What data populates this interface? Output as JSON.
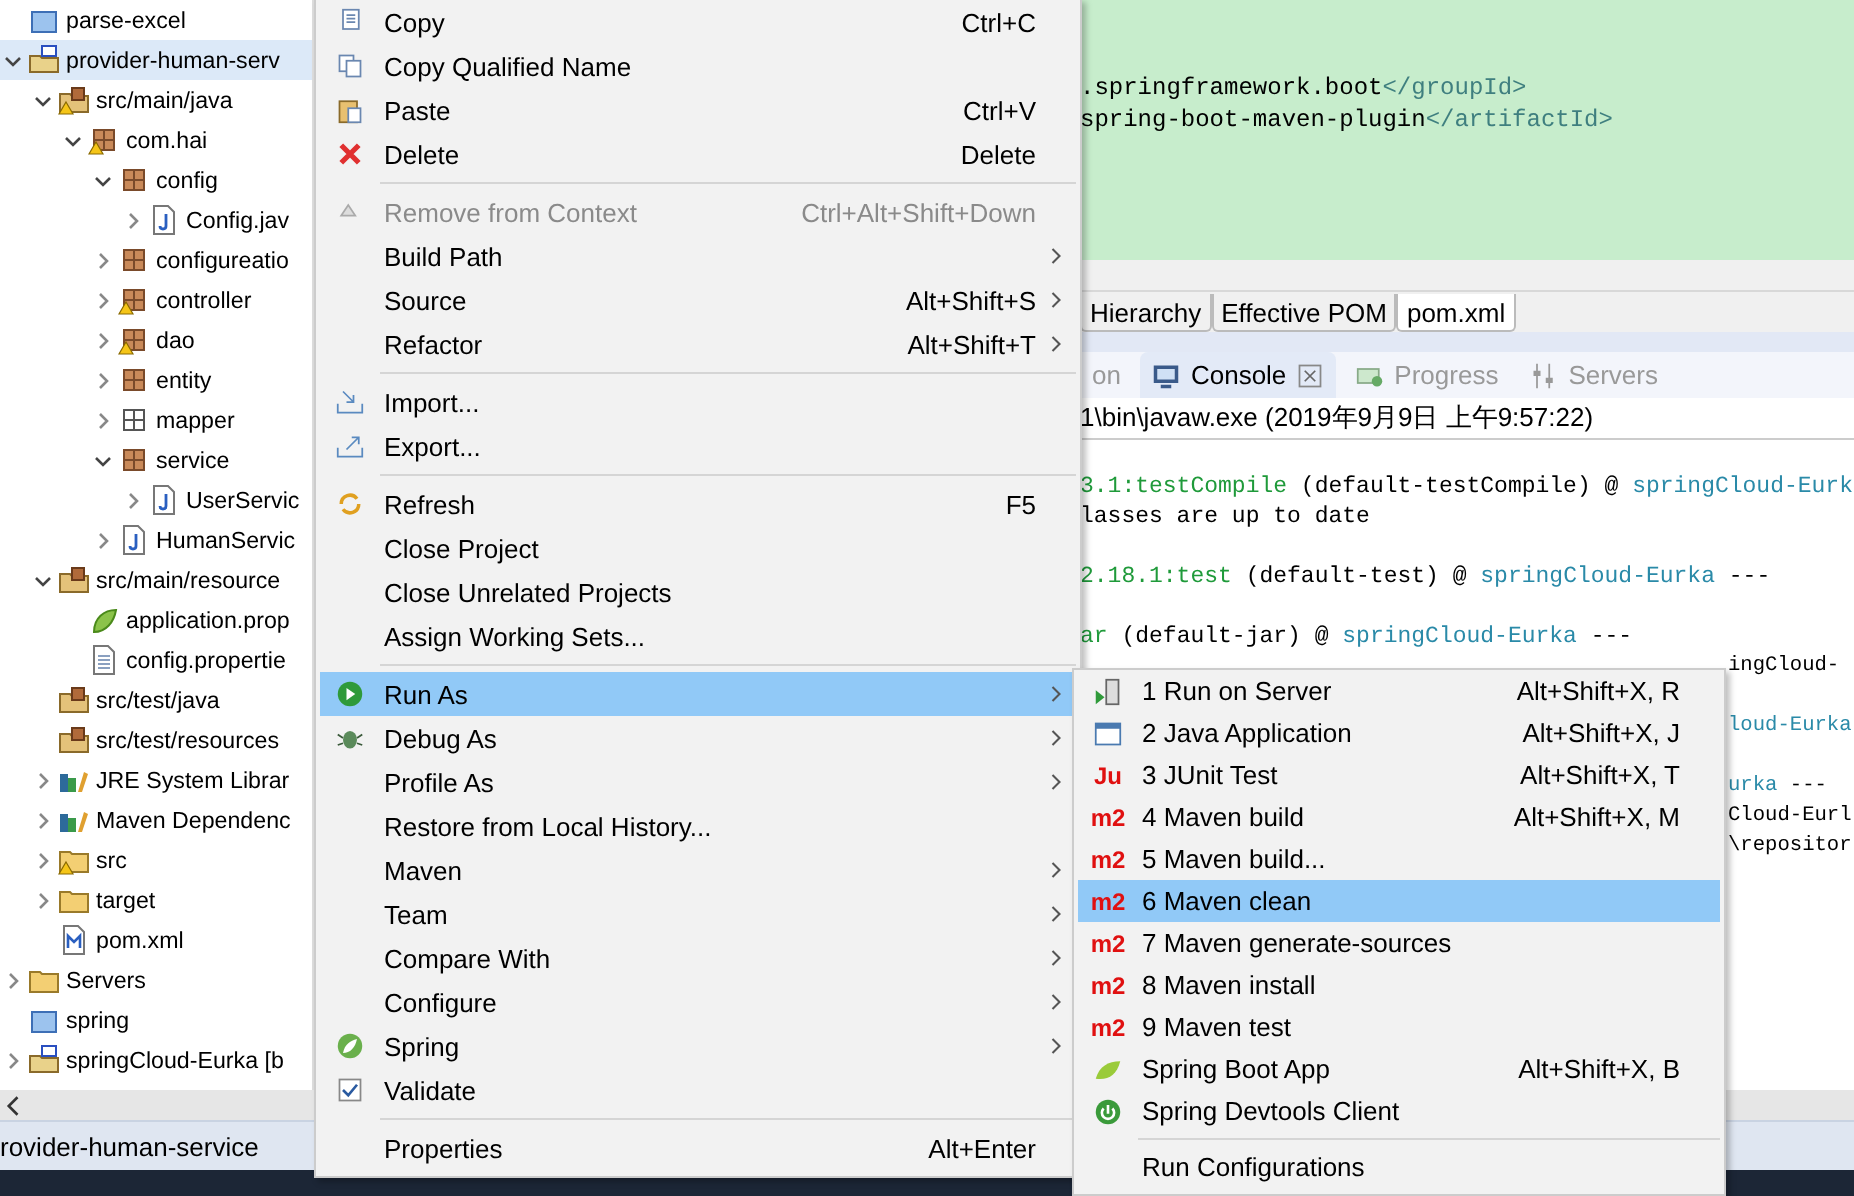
{
  "project_tree": {
    "items": [
      {
        "label": "parse-excel",
        "kind": "project",
        "selected": false
      },
      {
        "label": "provider-human-serv",
        "kind": "maven-project",
        "selected": true,
        "expanded": true,
        "children": [
          {
            "label": "src/main/java",
            "kind": "source-folder",
            "warning": true,
            "selected": false,
            "expanded": true,
            "children": [
              {
                "label": "com.hai",
                "kind": "package",
                "warning": true,
                "selected": false,
                "expanded": true,
                "children": [
                  {
                    "label": "config",
                    "kind": "package",
                    "selected": false,
                    "expanded": true,
                    "children": [
                      {
                        "label": "Config.jav",
                        "kind": "java-file",
                        "selected": false,
                        "expanded": false
                      }
                    ]
                  },
                  {
                    "label": "configureatio",
                    "kind": "package",
                    "selected": false,
                    "expanded": false
                  },
                  {
                    "label": "controller",
                    "kind": "package",
                    "warning": true,
                    "selected": false,
                    "expanded": false
                  },
                  {
                    "label": "dao",
                    "kind": "package",
                    "warning": true,
                    "selected": false,
                    "expanded": false
                  },
                  {
                    "label": "entity",
                    "kind": "package",
                    "selected": false,
                    "expanded": false
                  },
                  {
                    "label": "mapper",
                    "kind": "empty-package",
                    "selected": false,
                    "expanded": false
                  },
                  {
                    "label": "service",
                    "kind": "package",
                    "selected": false,
                    "expanded": true,
                    "children": [
                      {
                        "label": "UserServic",
                        "kind": "java-file",
                        "selected": false,
                        "expanded": false
                      }
                    ]
                  },
                  {
                    "label": "HumanServic",
                    "kind": "java-file",
                    "selected": false,
                    "expanded": false
                  }
                ]
              }
            ]
          },
          {
            "label": "src/main/resource",
            "kind": "source-folder",
            "selected": false,
            "expanded": true,
            "children": [
              {
                "label": "application.prop",
                "kind": "spring-file",
                "selected": false
              },
              {
                "label": "config.propertie",
                "kind": "text-file",
                "selected": false
              }
            ]
          },
          {
            "label": "src/test/java",
            "kind": "source-folder",
            "selected": false
          },
          {
            "label": "src/test/resources",
            "kind": "source-folder",
            "selected": false
          },
          {
            "label": "JRE System Librar",
            "kind": "library",
            "selected": false,
            "expanded": false
          },
          {
            "label": "Maven Dependenc",
            "kind": "library",
            "selected": false,
            "expanded": false
          },
          {
            "label": "src",
            "kind": "folder",
            "warning": true,
            "selected": false,
            "expanded": false
          },
          {
            "label": "target",
            "kind": "folder",
            "selected": false,
            "expanded": false
          },
          {
            "label": "pom.xml",
            "kind": "xml-file",
            "selected": false
          }
        ]
      },
      {
        "label": "Servers",
        "kind": "folder",
        "selected": false,
        "expanded": false
      },
      {
        "label": "spring",
        "kind": "project",
        "selected": false
      },
      {
        "label": "springCloud-Eurka [b",
        "kind": "maven-project",
        "selected": false,
        "expanded": false
      }
    ]
  },
  "editor": {
    "lines": [
      {
        "segments": [
          {
            "text": ".springframework.boot",
            "kind": "text"
          },
          {
            "text": "</groupId>",
            "kind": "tag"
          }
        ]
      },
      {
        "segments": [
          {
            "text": "spring-boot-maven-plugin",
            "kind": "text"
          },
          {
            "text": "</artifactId>",
            "kind": "tag"
          }
        ]
      }
    ],
    "tabs": [
      {
        "label": "Hierarchy",
        "selected": false
      },
      {
        "label": "Effective POM",
        "selected": false
      },
      {
        "label": "pom.xml",
        "selected": true
      }
    ]
  },
  "console": {
    "tabs": [
      {
        "label": "on",
        "selected": false
      },
      {
        "label": "Console",
        "selected": true
      },
      {
        "label": "Progress",
        "selected": false
      },
      {
        "label": "Servers",
        "selected": false
      }
    ],
    "header": "1\\bin\\javaw.exe (2019年9月9日 上午9:57:22)",
    "blocks": [
      {
        "lines": [
          {
            "kind": "line",
            "segments": [
              {
                "text": "3.1:testCompile",
                "kind": "plugin"
              },
              {
                "text": " (default-testCompile) @ ",
                "kind": "plain"
              },
              {
                "text": "springCloud-Eurk",
                "kind": "project"
              }
            ]
          },
          {
            "kind": "line",
            "segments": [
              {
                "text": "lasses are up to date",
                "kind": "plain"
              }
            ]
          }
        ]
      },
      {
        "lines": [
          {
            "kind": "line",
            "segments": [
              {
                "text": "2.18.1:test",
                "kind": "plugin"
              },
              {
                "text": " (default-test) @ ",
                "kind": "plain"
              },
              {
                "text": "springCloud-Eurka",
                "kind": "project"
              },
              {
                "text": " ---",
                "kind": "plain"
              }
            ]
          }
        ]
      },
      {
        "lines": [
          {
            "kind": "line",
            "segments": [
              {
                "text": "ar",
                "kind": "plugin"
              },
              {
                "text": " (default-jar) @ ",
                "kind": "plain"
              },
              {
                "text": "springCloud-Eurka",
                "kind": "project"
              },
              {
                "text": " ---",
                "kind": "plain"
              }
            ]
          },
          {
            "kind": "tail",
            "segments": [
              {
                "text": "ingCloud-",
                "kind": "plain"
              }
            ]
          }
        ]
      },
      {
        "lines": [
          {
            "kind": "tail",
            "segments": [
              {
                "text": "loud-Eurka",
                "kind": "project"
              }
            ]
          }
        ]
      },
      {
        "lines": [
          {
            "kind": "tail",
            "segments": [
              {
                "text": "urka",
                "kind": "project"
              },
              {
                "text": " ---",
                "kind": "plain"
              }
            ]
          },
          {
            "kind": "tail",
            "segments": [
              {
                "text": "Cloud-Eurl",
                "kind": "plain"
              }
            ]
          },
          {
            "kind": "tail",
            "segments": [
              {
                "text": "\\repositor",
                "kind": "plain"
              }
            ]
          }
        ]
      }
    ]
  },
  "status_bar": {
    "text": "rovider-human-service"
  },
  "context_menu": {
    "items": [
      {
        "kind": "item",
        "label": "Copy",
        "shortcut": "Ctrl+C",
        "disabled": false,
        "submenu": false,
        "selected": false
      },
      {
        "kind": "item",
        "label": "Copy Qualified Name",
        "disabled": false,
        "submenu": false,
        "selected": false
      },
      {
        "kind": "item",
        "label": "Paste",
        "shortcut": "Ctrl+V",
        "disabled": false,
        "submenu": false,
        "selected": false
      },
      {
        "kind": "item",
        "label": "Delete",
        "shortcut": "Delete",
        "disabled": false,
        "submenu": false,
        "selected": false
      },
      {
        "kind": "separator"
      },
      {
        "kind": "item",
        "label": "Remove from Context",
        "shortcut": "Ctrl+Alt+Shift+Down",
        "disabled": true,
        "submenu": false,
        "selected": false
      },
      {
        "kind": "item",
        "label": "Build Path",
        "disabled": false,
        "submenu": true,
        "selected": false
      },
      {
        "kind": "item",
        "label": "Source",
        "shortcut": "Alt+Shift+S",
        "disabled": false,
        "submenu": true,
        "selected": false
      },
      {
        "kind": "item",
        "label": "Refactor",
        "shortcut": "Alt+Shift+T",
        "disabled": false,
        "submenu": true,
        "selected": false
      },
      {
        "kind": "separator"
      },
      {
        "kind": "item",
        "label": "Import...",
        "disabled": false,
        "submenu": false,
        "selected": false
      },
      {
        "kind": "item",
        "label": "Export...",
        "disabled": false,
        "submenu": false,
        "selected": false
      },
      {
        "kind": "separator"
      },
      {
        "kind": "item",
        "label": "Refresh",
        "shortcut": "F5",
        "disabled": false,
        "submenu": false,
        "selected": false
      },
      {
        "kind": "item",
        "label": "Close Project",
        "disabled": false,
        "submenu": false,
        "selected": false
      },
      {
        "kind": "item",
        "label": "Close Unrelated Projects",
        "disabled": false,
        "submenu": false,
        "selected": false
      },
      {
        "kind": "item",
        "label": "Assign Working Sets...",
        "disabled": false,
        "submenu": false,
        "selected": false
      },
      {
        "kind": "separator"
      },
      {
        "kind": "item",
        "label": "Run As",
        "disabled": false,
        "submenu": true,
        "selected": true
      },
      {
        "kind": "item",
        "label": "Debug As",
        "disabled": false,
        "submenu": true,
        "selected": false
      },
      {
        "kind": "item",
        "label": "Profile As",
        "disabled": false,
        "submenu": true,
        "selected": false
      },
      {
        "kind": "item",
        "label": "Restore from Local History...",
        "disabled": false,
        "submenu": false,
        "selected": false
      },
      {
        "kind": "item",
        "label": "Maven",
        "disabled": false,
        "submenu": true,
        "selected": false
      },
      {
        "kind": "item",
        "label": "Team",
        "disabled": false,
        "submenu": true,
        "selected": false
      },
      {
        "kind": "item",
        "label": "Compare With",
        "disabled": false,
        "submenu": true,
        "selected": false
      },
      {
        "kind": "item",
        "label": "Configure",
        "disabled": false,
        "submenu": true,
        "selected": false
      },
      {
        "kind": "item",
        "label": "Spring",
        "disabled": false,
        "submenu": true,
        "selected": false
      },
      {
        "kind": "item",
        "label": "Validate",
        "disabled": false,
        "submenu": false,
        "selected": false
      },
      {
        "kind": "separator"
      },
      {
        "kind": "item",
        "label": "Properties",
        "shortcut": "Alt+Enter",
        "disabled": false,
        "submenu": false,
        "selected": false
      }
    ]
  },
  "submenu": {
    "items": [
      {
        "kind": "item",
        "label": "1 Run on Server",
        "shortcut": "Alt+Shift+X, R",
        "selected": false
      },
      {
        "kind": "item",
        "label": "2 Java Application",
        "shortcut": "Alt+Shift+X, J",
        "selected": false
      },
      {
        "kind": "item",
        "label": "3 JUnit Test",
        "shortcut": "Alt+Shift+X, T",
        "badge": "Ju",
        "selected": false
      },
      {
        "kind": "item",
        "label": "4 Maven build",
        "shortcut": "Alt+Shift+X, M",
        "badge": "m2",
        "selected": false
      },
      {
        "kind": "item",
        "label": "5 Maven build...",
        "badge": "m2",
        "selected": false
      },
      {
        "kind": "item",
        "label": "6 Maven clean",
        "badge": "m2",
        "selected": true
      },
      {
        "kind": "item",
        "label": "7 Maven generate-sources",
        "badge": "m2",
        "selected": false
      },
      {
        "kind": "item",
        "label": "8 Maven install",
        "badge": "m2",
        "selected": false
      },
      {
        "kind": "item",
        "label": "9 Maven test",
        "badge": "m2",
        "selected": false
      },
      {
        "kind": "item",
        "label": "Spring Boot App",
        "shortcut": "Alt+Shift+X, B",
        "selected": false
      },
      {
        "kind": "item",
        "label": "Spring Devtools Client",
        "selected": false
      },
      {
        "kind": "separator"
      },
      {
        "kind": "item",
        "label": "Run Configurations",
        "selected": false
      }
    ]
  }
}
